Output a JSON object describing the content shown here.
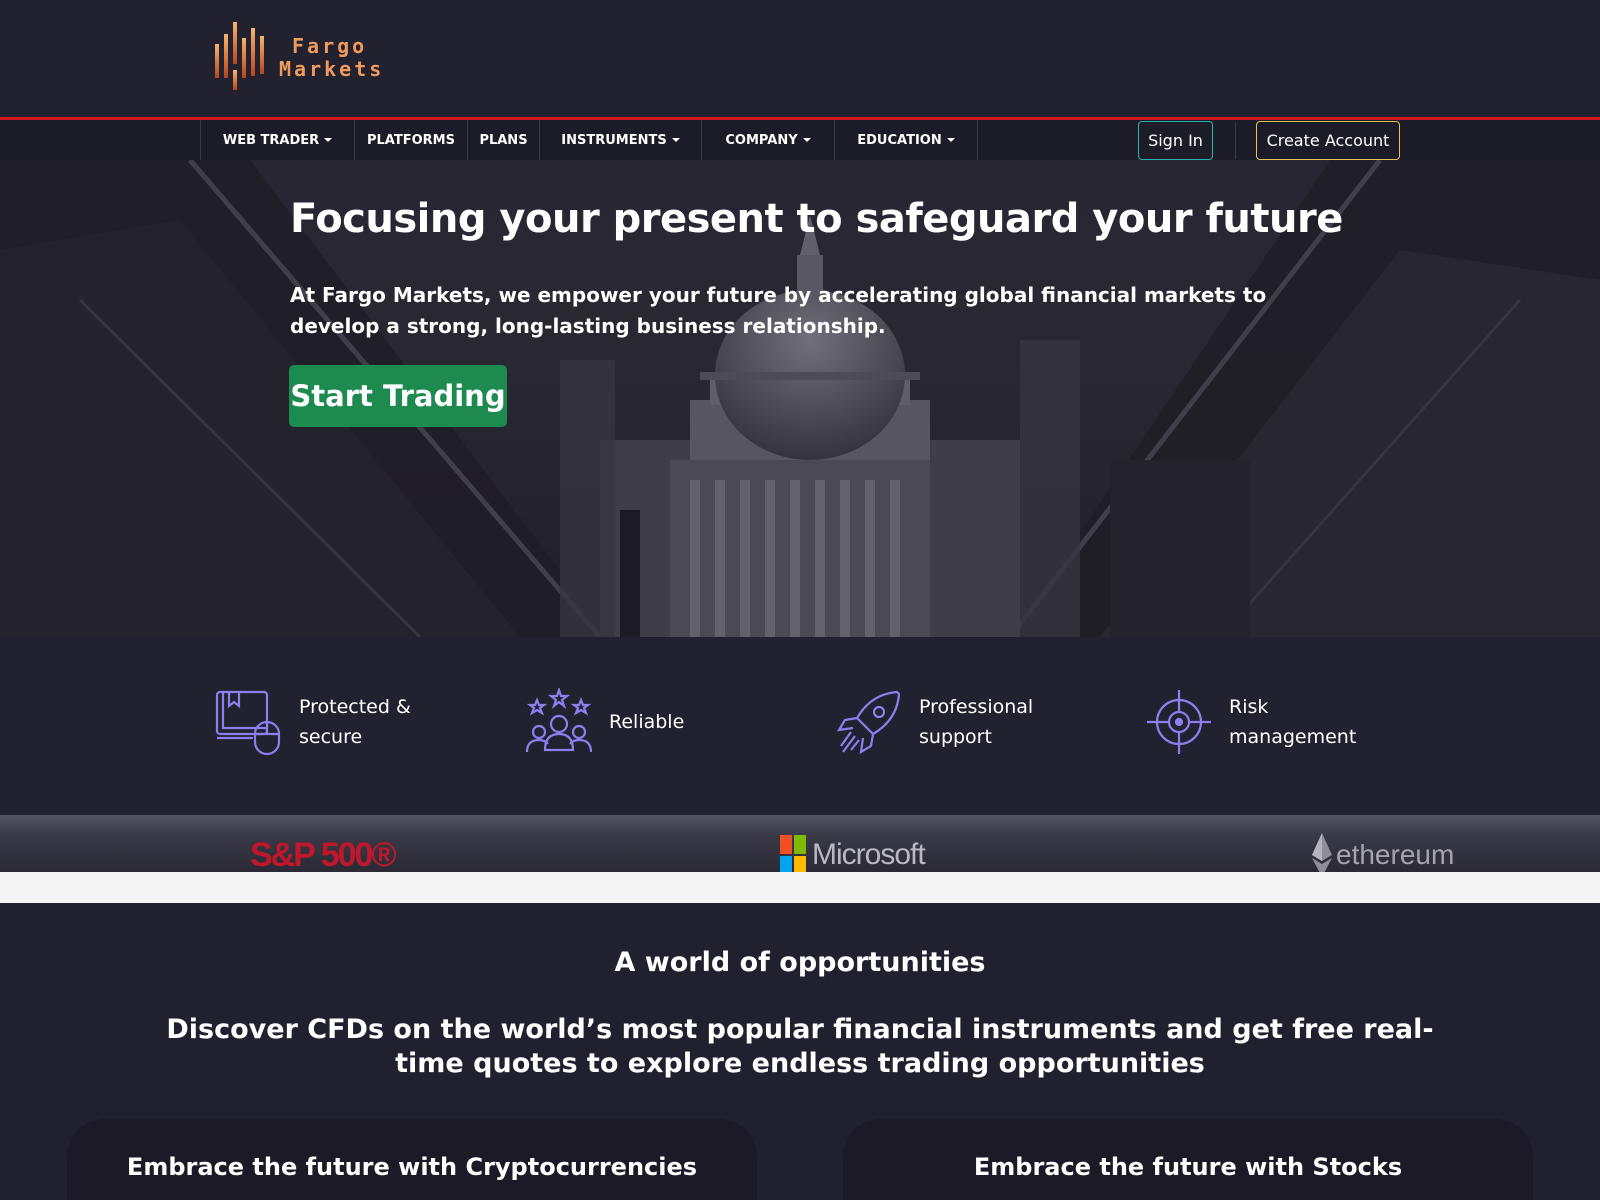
{
  "brand": {
    "line1": "Fargo",
    "line2": "Markets",
    "accent": "#f09a5c"
  },
  "nav": {
    "items": [
      {
        "label": "WEB TRADER",
        "dropdown": true
      },
      {
        "label": "PLATFORMS",
        "dropdown": false
      },
      {
        "label": "PLANS",
        "dropdown": false
      },
      {
        "label": "INSTRUMENTS",
        "dropdown": true
      },
      {
        "label": "COMPANY",
        "dropdown": true
      },
      {
        "label": "EDUCATION",
        "dropdown": true
      }
    ],
    "signin_label": "Sign In",
    "create_label": "Create Account",
    "accent_line": "#d3171f"
  },
  "hero": {
    "title": "Focusing your present to safeguard your future",
    "subtitle": "At Fargo Markets, we empower your future by accelerating global financial markets to develop a strong, long-lasting business relationship.",
    "cta_label": "Start Trading",
    "cta_color": "#1d8b4f"
  },
  "features": [
    {
      "label": "Protected & secure",
      "icon": "book-mouse-icon"
    },
    {
      "label": "Reliable",
      "icon": "team-stars-icon"
    },
    {
      "label": "Professional support",
      "icon": "rocket-icon"
    },
    {
      "label": "Risk management",
      "icon": "crosshair-icon"
    }
  ],
  "brands": {
    "sp": "S&P 500®",
    "microsoft": "Microsoft",
    "ethereum": "ethereum"
  },
  "opportunities": {
    "title": "A world of opportunities",
    "subtitle": "Discover CFDs on the world’s most popular financial instruments and get free real-time quotes to explore endless trading opportunities",
    "cards": [
      {
        "title": "Embrace the future with Cryptocurrencies"
      },
      {
        "title": "Embrace the future with Stocks"
      }
    ]
  }
}
